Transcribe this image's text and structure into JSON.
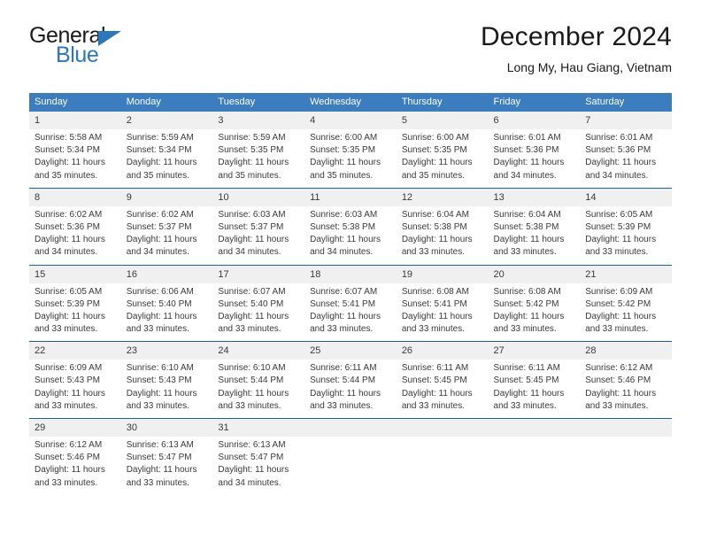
{
  "brand": {
    "name_top": "General",
    "name_bottom": "Blue",
    "triangle_color": "#2b77bd"
  },
  "header": {
    "title": "December 2024",
    "subtitle": "Long My, Hau Giang, Vietnam"
  },
  "colors": {
    "header_blue": "#3b7dbf",
    "rule_blue": "#1c5fa5",
    "daynum_bg": "#f0f0f0",
    "brand_blue": "#2b77bd"
  },
  "weekdays": [
    "Sunday",
    "Monday",
    "Tuesday",
    "Wednesday",
    "Thursday",
    "Friday",
    "Saturday"
  ],
  "weeks": [
    [
      {
        "day": "1",
        "sunrise": "Sunrise: 5:58 AM",
        "sunset": "Sunset: 5:34 PM",
        "daylight1": "Daylight: 11 hours",
        "daylight2": "and 35 minutes."
      },
      {
        "day": "2",
        "sunrise": "Sunrise: 5:59 AM",
        "sunset": "Sunset: 5:34 PM",
        "daylight1": "Daylight: 11 hours",
        "daylight2": "and 35 minutes."
      },
      {
        "day": "3",
        "sunrise": "Sunrise: 5:59 AM",
        "sunset": "Sunset: 5:35 PM",
        "daylight1": "Daylight: 11 hours",
        "daylight2": "and 35 minutes."
      },
      {
        "day": "4",
        "sunrise": "Sunrise: 6:00 AM",
        "sunset": "Sunset: 5:35 PM",
        "daylight1": "Daylight: 11 hours",
        "daylight2": "and 35 minutes."
      },
      {
        "day": "5",
        "sunrise": "Sunrise: 6:00 AM",
        "sunset": "Sunset: 5:35 PM",
        "daylight1": "Daylight: 11 hours",
        "daylight2": "and 35 minutes."
      },
      {
        "day": "6",
        "sunrise": "Sunrise: 6:01 AM",
        "sunset": "Sunset: 5:36 PM",
        "daylight1": "Daylight: 11 hours",
        "daylight2": "and 34 minutes."
      },
      {
        "day": "7",
        "sunrise": "Sunrise: 6:01 AM",
        "sunset": "Sunset: 5:36 PM",
        "daylight1": "Daylight: 11 hours",
        "daylight2": "and 34 minutes."
      }
    ],
    [
      {
        "day": "8",
        "sunrise": "Sunrise: 6:02 AM",
        "sunset": "Sunset: 5:36 PM",
        "daylight1": "Daylight: 11 hours",
        "daylight2": "and 34 minutes."
      },
      {
        "day": "9",
        "sunrise": "Sunrise: 6:02 AM",
        "sunset": "Sunset: 5:37 PM",
        "daylight1": "Daylight: 11 hours",
        "daylight2": "and 34 minutes."
      },
      {
        "day": "10",
        "sunrise": "Sunrise: 6:03 AM",
        "sunset": "Sunset: 5:37 PM",
        "daylight1": "Daylight: 11 hours",
        "daylight2": "and 34 minutes."
      },
      {
        "day": "11",
        "sunrise": "Sunrise: 6:03 AM",
        "sunset": "Sunset: 5:38 PM",
        "daylight1": "Daylight: 11 hours",
        "daylight2": "and 34 minutes."
      },
      {
        "day": "12",
        "sunrise": "Sunrise: 6:04 AM",
        "sunset": "Sunset: 5:38 PM",
        "daylight1": "Daylight: 11 hours",
        "daylight2": "and 33 minutes."
      },
      {
        "day": "13",
        "sunrise": "Sunrise: 6:04 AM",
        "sunset": "Sunset: 5:38 PM",
        "daylight1": "Daylight: 11 hours",
        "daylight2": "and 33 minutes."
      },
      {
        "day": "14",
        "sunrise": "Sunrise: 6:05 AM",
        "sunset": "Sunset: 5:39 PM",
        "daylight1": "Daylight: 11 hours",
        "daylight2": "and 33 minutes."
      }
    ],
    [
      {
        "day": "15",
        "sunrise": "Sunrise: 6:05 AM",
        "sunset": "Sunset: 5:39 PM",
        "daylight1": "Daylight: 11 hours",
        "daylight2": "and 33 minutes."
      },
      {
        "day": "16",
        "sunrise": "Sunrise: 6:06 AM",
        "sunset": "Sunset: 5:40 PM",
        "daylight1": "Daylight: 11 hours",
        "daylight2": "and 33 minutes."
      },
      {
        "day": "17",
        "sunrise": "Sunrise: 6:07 AM",
        "sunset": "Sunset: 5:40 PM",
        "daylight1": "Daylight: 11 hours",
        "daylight2": "and 33 minutes."
      },
      {
        "day": "18",
        "sunrise": "Sunrise: 6:07 AM",
        "sunset": "Sunset: 5:41 PM",
        "daylight1": "Daylight: 11 hours",
        "daylight2": "and 33 minutes."
      },
      {
        "day": "19",
        "sunrise": "Sunrise: 6:08 AM",
        "sunset": "Sunset: 5:41 PM",
        "daylight1": "Daylight: 11 hours",
        "daylight2": "and 33 minutes."
      },
      {
        "day": "20",
        "sunrise": "Sunrise: 6:08 AM",
        "sunset": "Sunset: 5:42 PM",
        "daylight1": "Daylight: 11 hours",
        "daylight2": "and 33 minutes."
      },
      {
        "day": "21",
        "sunrise": "Sunrise: 6:09 AM",
        "sunset": "Sunset: 5:42 PM",
        "daylight1": "Daylight: 11 hours",
        "daylight2": "and 33 minutes."
      }
    ],
    [
      {
        "day": "22",
        "sunrise": "Sunrise: 6:09 AM",
        "sunset": "Sunset: 5:43 PM",
        "daylight1": "Daylight: 11 hours",
        "daylight2": "and 33 minutes."
      },
      {
        "day": "23",
        "sunrise": "Sunrise: 6:10 AM",
        "sunset": "Sunset: 5:43 PM",
        "daylight1": "Daylight: 11 hours",
        "daylight2": "and 33 minutes."
      },
      {
        "day": "24",
        "sunrise": "Sunrise: 6:10 AM",
        "sunset": "Sunset: 5:44 PM",
        "daylight1": "Daylight: 11 hours",
        "daylight2": "and 33 minutes."
      },
      {
        "day": "25",
        "sunrise": "Sunrise: 6:11 AM",
        "sunset": "Sunset: 5:44 PM",
        "daylight1": "Daylight: 11 hours",
        "daylight2": "and 33 minutes."
      },
      {
        "day": "26",
        "sunrise": "Sunrise: 6:11 AM",
        "sunset": "Sunset: 5:45 PM",
        "daylight1": "Daylight: 11 hours",
        "daylight2": "and 33 minutes."
      },
      {
        "day": "27",
        "sunrise": "Sunrise: 6:11 AM",
        "sunset": "Sunset: 5:45 PM",
        "daylight1": "Daylight: 11 hours",
        "daylight2": "and 33 minutes."
      },
      {
        "day": "28",
        "sunrise": "Sunrise: 6:12 AM",
        "sunset": "Sunset: 5:46 PM",
        "daylight1": "Daylight: 11 hours",
        "daylight2": "and 33 minutes."
      }
    ],
    [
      {
        "day": "29",
        "sunrise": "Sunrise: 6:12 AM",
        "sunset": "Sunset: 5:46 PM",
        "daylight1": "Daylight: 11 hours",
        "daylight2": "and 33 minutes."
      },
      {
        "day": "30",
        "sunrise": "Sunrise: 6:13 AM",
        "sunset": "Sunset: 5:47 PM",
        "daylight1": "Daylight: 11 hours",
        "daylight2": "and 33 minutes."
      },
      {
        "day": "31",
        "sunrise": "Sunrise: 6:13 AM",
        "sunset": "Sunset: 5:47 PM",
        "daylight1": "Daylight: 11 hours",
        "daylight2": "and 34 minutes."
      },
      null,
      null,
      null,
      null
    ]
  ]
}
